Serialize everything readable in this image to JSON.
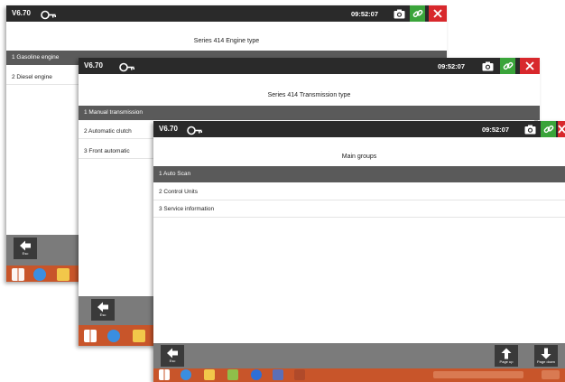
{
  "app": {
    "version": "V6.70"
  },
  "windows": [
    {
      "id": "engine",
      "time": "09:52:07",
      "page_title": "Series 414 Engine type",
      "items": [
        "1 Gasoline engine",
        "2 Diesel engine"
      ],
      "selected": 0,
      "footer": {
        "back_label": "Esc"
      }
    },
    {
      "id": "transmission",
      "time": "09:52:07",
      "page_title": "Series 414 Transmission type",
      "items": [
        "1 Manual transmission",
        "2 Automatic clutch",
        "3 Front automatic"
      ],
      "selected": 0,
      "footer": {
        "back_label": "Esc"
      }
    },
    {
      "id": "main",
      "time": "09:52:07",
      "page_title": "Main groups",
      "items": [
        "1 Auto Scan",
        "2 Control Units",
        "3 Service information"
      ],
      "selected": 0,
      "footer": {
        "back_label": "Esc",
        "page_up_label": "Page up",
        "page_down_label": "Page down"
      }
    }
  ],
  "colors": {
    "titlebar": "#2a2a2a",
    "selected_row": "#5a5a5a",
    "footer": "#7b7b7b",
    "taskbar": "#c8552a",
    "link_button": "#3aa43a",
    "close_button": "#d8282c"
  },
  "icons": {
    "titlebar": [
      "key-icon",
      "camera-icon",
      "link-icon",
      "close-icon"
    ],
    "footer": [
      "back-arrow-icon",
      "page-up-icon",
      "page-down-icon"
    ],
    "taskbar": [
      "windows-start-icon",
      "internet-explorer-icon",
      "file-explorer-icon"
    ]
  }
}
